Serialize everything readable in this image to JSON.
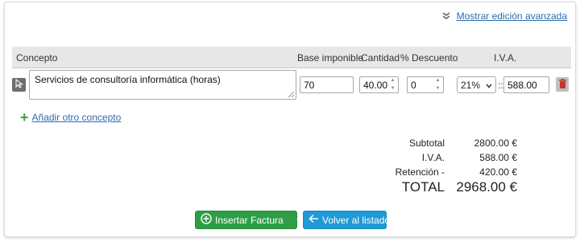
{
  "advanced_link": {
    "label": "Mostrar edición avanzada",
    "icon": "double-chevron-down-icon"
  },
  "table": {
    "headers": {
      "concept": "Concepto",
      "base": "Base imponible",
      "qty": "Cantidad",
      "discount": "% Descuento",
      "iva": "I.V.A."
    },
    "row": {
      "concept": "Servicios de consultoría informática (horas)",
      "base": "70",
      "qty": "40.00",
      "discount": "0",
      "iva_rate": "21%",
      "iva_sep": "::",
      "iva_amount": "588.00"
    }
  },
  "add_link": {
    "label": "Añadir otro concepto",
    "icon": "plus-icon"
  },
  "totals": {
    "subtotal_label": "Subtotal",
    "subtotal_value": "2800.00 €",
    "iva_label": "I.V.A.",
    "iva_value": "588.00 €",
    "ret_label": "Retención -",
    "ret_value": "420.00 €",
    "total_label": "TOTAL",
    "total_value": "2968.00 €"
  },
  "buttons": {
    "insert": "Insertar Factura",
    "back": "Volver al listado"
  },
  "colors": {
    "green": "#2e9e46",
    "blue": "#1e9ad6",
    "link": "#2b6cb0",
    "trash": "#c0392b"
  }
}
